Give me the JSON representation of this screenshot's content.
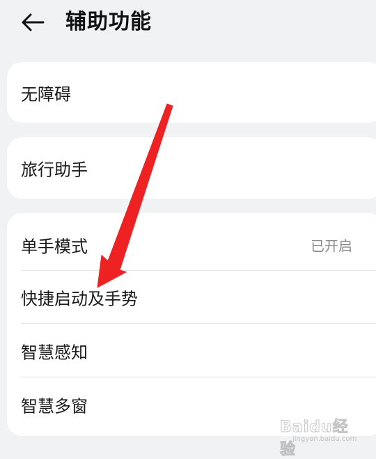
{
  "header": {
    "title": "辅助功能"
  },
  "cards": [
    {
      "rows": [
        {
          "label": "无障碍",
          "value": ""
        }
      ]
    },
    {
      "rows": [
        {
          "label": "旅行助手",
          "value": ""
        }
      ]
    },
    {
      "rows": [
        {
          "label": "单手模式",
          "value": "已开启"
        },
        {
          "label": "快捷启动及手势",
          "value": ""
        },
        {
          "label": "智慧感知",
          "value": ""
        },
        {
          "label": "智慧多窗",
          "value": ""
        }
      ]
    }
  ],
  "watermark": {
    "text": "Baidu经验",
    "sub": "jingyan.baidu.com"
  },
  "colors": {
    "background": "#f1f2f4",
    "card": "#ffffff",
    "annotation_arrow": "#ee2222",
    "secondary_text": "#8a8a8a"
  },
  "icons": [
    "back-arrow-icon",
    "chevron-right-icon"
  ]
}
